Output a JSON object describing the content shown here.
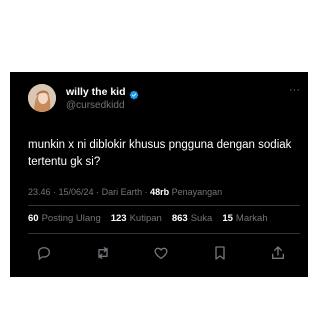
{
  "tweet": {
    "author": {
      "display_name": "willy the kid",
      "handle": "@cursedkidd",
      "verified": true
    },
    "more_label": "···",
    "text": "munkin x ni diblokir khusus pngguna dengan sodiak tertentu gk si?",
    "meta": {
      "time": "23.46",
      "separator1": " · ",
      "date": "15/06/24",
      "separator2": " · ",
      "source": "Dari Earth",
      "separator3": " · ",
      "views_count": "48rb",
      "views_label": "Penayangan"
    },
    "stats": [
      {
        "count": "60",
        "label": "Posting Ulang"
      },
      {
        "count": "123",
        "label": "Kutipan"
      },
      {
        "count": "863",
        "label": "Suka"
      },
      {
        "count": "15",
        "label": "Markah"
      }
    ],
    "actions": [
      {
        "icon": "reply-icon"
      },
      {
        "icon": "repost-icon"
      },
      {
        "icon": "like-icon"
      },
      {
        "icon": "bookmark-icon"
      },
      {
        "icon": "share-icon"
      }
    ]
  },
  "colors": {
    "background": "#000000",
    "text": "#ffffff",
    "muted": "#71767b",
    "verified": "#1d9bf0",
    "divider": "#2f3336"
  }
}
